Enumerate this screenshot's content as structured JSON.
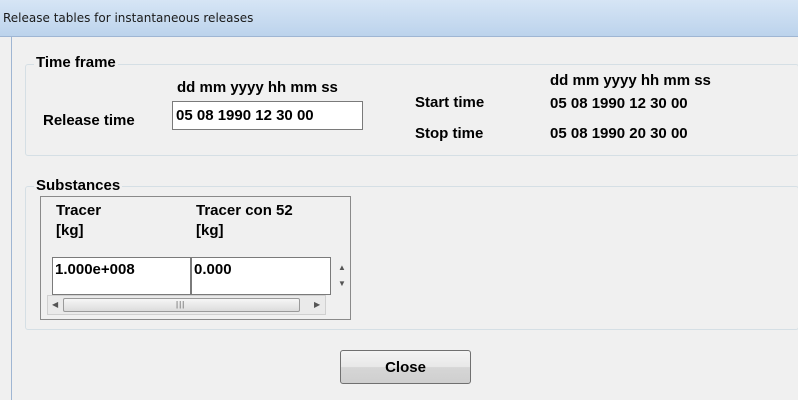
{
  "window": {
    "title": "Release tables for instantaneous releases"
  },
  "time_frame": {
    "group_title": "Time frame",
    "format_left": "dd mm yyyy hh mm ss",
    "format_right": "dd mm yyyy hh mm ss",
    "release_time_label": "Release time",
    "release_time_value": "05 08 1990 12 30 00",
    "start_time_label": "Start time",
    "start_time_value": "05 08 1990 12 30 00",
    "stop_time_label": "Stop time",
    "stop_time_value": "05 08 1990 20 30 00"
  },
  "substances": {
    "group_title": "Substances",
    "columns": [
      {
        "name": "Tracer",
        "unit": "[kg]",
        "value": "1.000e+008"
      },
      {
        "name": "Tracer con 52",
        "unit": "[kg]",
        "value": "0.000"
      }
    ]
  },
  "buttons": {
    "close_label": "Close"
  },
  "icons": {
    "scroll_up": "up-arrow-icon",
    "scroll_down": "down-arrow-icon",
    "scroll_left": "left-arrow-icon",
    "scroll_right": "right-arrow-icon"
  }
}
